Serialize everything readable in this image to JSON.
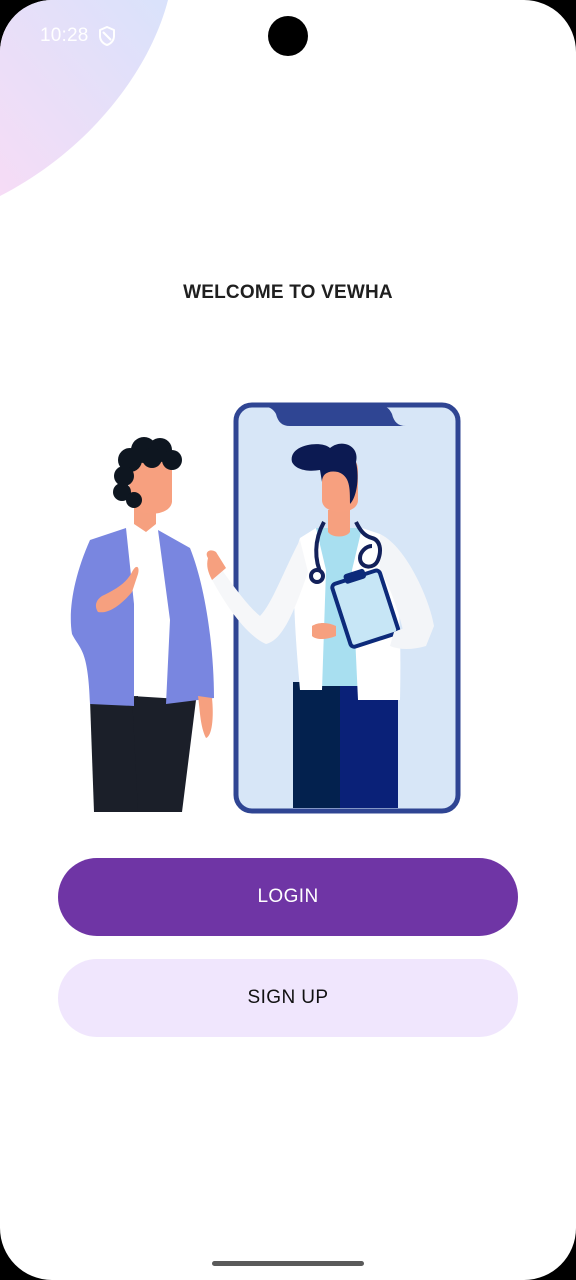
{
  "status_bar": {
    "time": "10:28",
    "icon": "shield-icon"
  },
  "welcome": {
    "title": "WELCOME TO VEWHA",
    "illustration": "patient-talking-to-doctor-on-phone"
  },
  "actions": {
    "login_label": "LOGIN",
    "signup_label": "SIGN UP"
  },
  "colors": {
    "primary": "#6f35a5",
    "secondary": "#f0e6fd",
    "blob_pink": "#f4d8f8",
    "blob_blue": "#dcdffb"
  }
}
